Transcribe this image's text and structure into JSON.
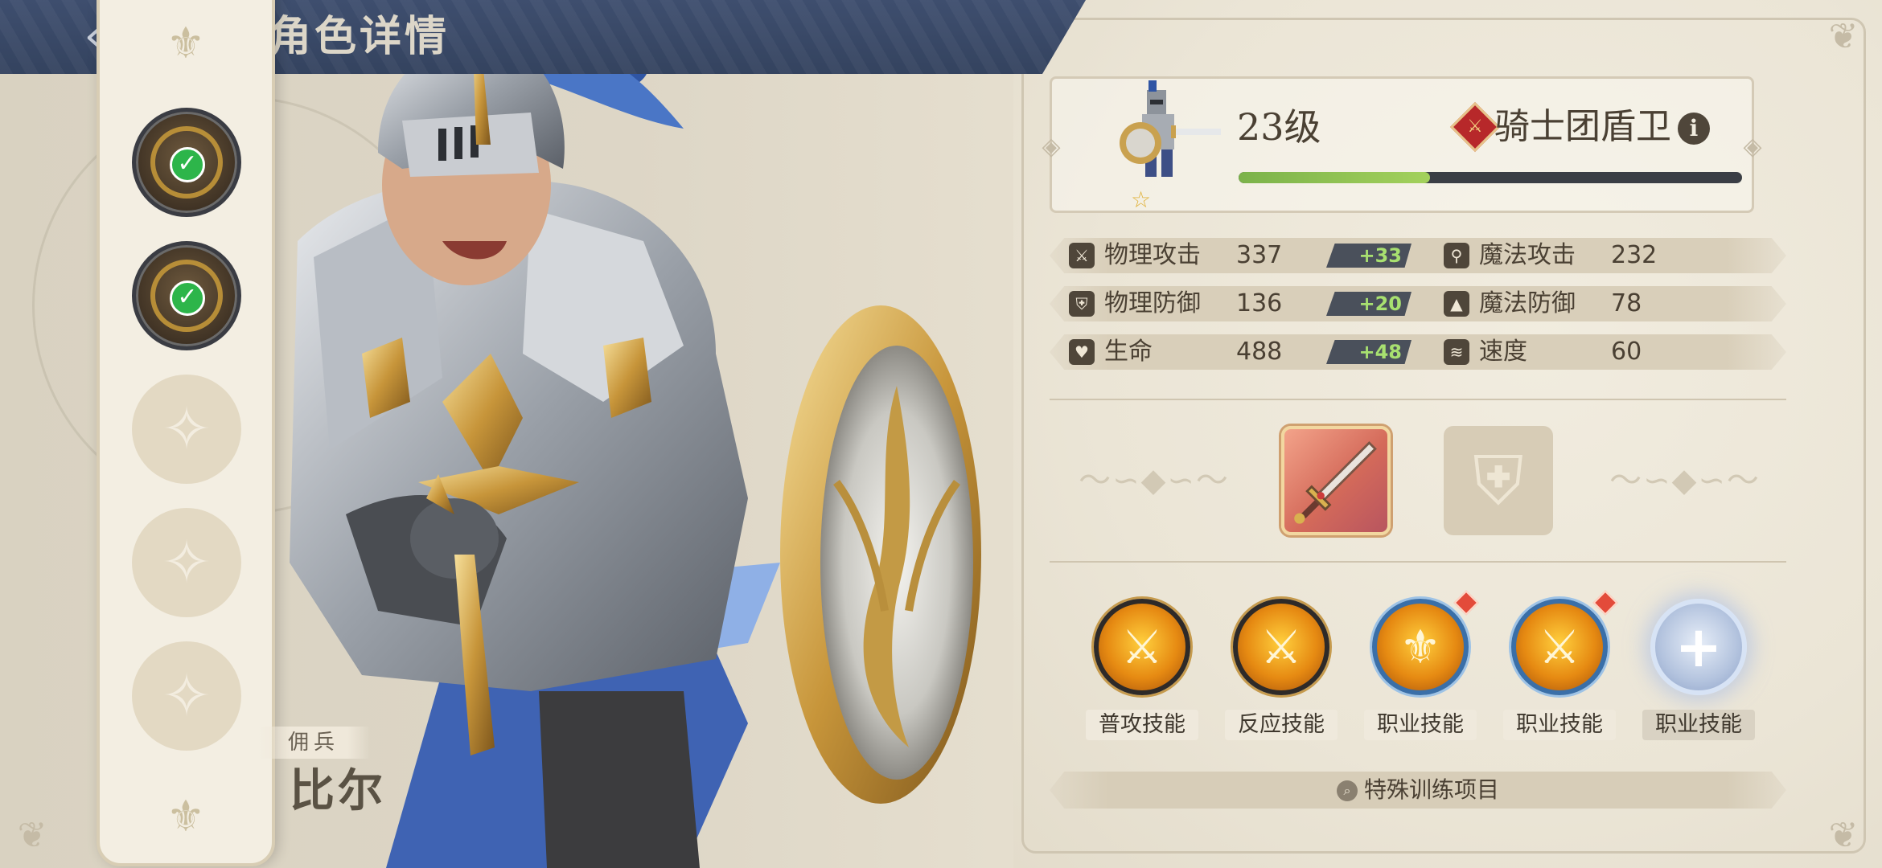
{
  "header": {
    "title": "角色详情",
    "back_icon": "back-arrow-icon"
  },
  "sidebar": {
    "slots": [
      {
        "state": "owned",
        "icon": "sword-emblem-icon",
        "checked": true
      },
      {
        "state": "owned",
        "icon": "shield-emblem-icon",
        "checked": true
      },
      {
        "state": "empty",
        "icon": "sparkle-staff-icon",
        "checked": false
      },
      {
        "state": "empty",
        "icon": "sparkle-staff-icon",
        "checked": false
      },
      {
        "state": "empty",
        "icon": "sparkle-staff-icon",
        "checked": false
      }
    ]
  },
  "hero": {
    "category": "佣兵",
    "name": "比尔"
  },
  "info": {
    "level": "23级",
    "class_name": "骑士团盾卫",
    "class_icon": "knight-class-icon",
    "stars": 1,
    "xp_fraction": 0.38
  },
  "stats": [
    {
      "icon": "sword-icon",
      "label": "物理攻击",
      "value": "337",
      "bonus": "+33"
    },
    {
      "icon": "staff-icon",
      "label": "魔法攻击",
      "value": "232",
      "bonus": ""
    },
    {
      "icon": "shield-icon",
      "label": "物理防御",
      "value": "136",
      "bonus": "+20"
    },
    {
      "icon": "wizard-hat-icon",
      "label": "魔法防御",
      "value": "78",
      "bonus": ""
    },
    {
      "icon": "heart-icon",
      "label": "生命",
      "value": "488",
      "bonus": "+48"
    },
    {
      "icon": "wing-icon",
      "label": "速度",
      "value": "60",
      "bonus": ""
    }
  ],
  "equipment": {
    "weapon": {
      "icon": "sword-equipment-icon"
    },
    "armor": {
      "icon": "empty-shield-slot-icon"
    }
  },
  "skills": [
    {
      "label": "普攻技能",
      "icon": "sword-skill-icon",
      "new": false
    },
    {
      "label": "反应技能",
      "icon": "sword-skill-icon",
      "new": false
    },
    {
      "label": "职业技能",
      "icon": "shield-crest-skill-icon",
      "new": true
    },
    {
      "label": "职业技能",
      "icon": "sword-skill-icon",
      "new": true
    },
    {
      "label": "职业技能",
      "icon": "add-skill-icon",
      "new": false
    }
  ],
  "training": {
    "label": "特殊训练项目",
    "icon": "search-icon"
  },
  "colors": {
    "header_bg": "#3e4e6e",
    "panel_bg": "#ebe5d6",
    "bonus_text": "#a8e070",
    "xp_fill": "#8cc152",
    "check_green": "#2db54a"
  }
}
